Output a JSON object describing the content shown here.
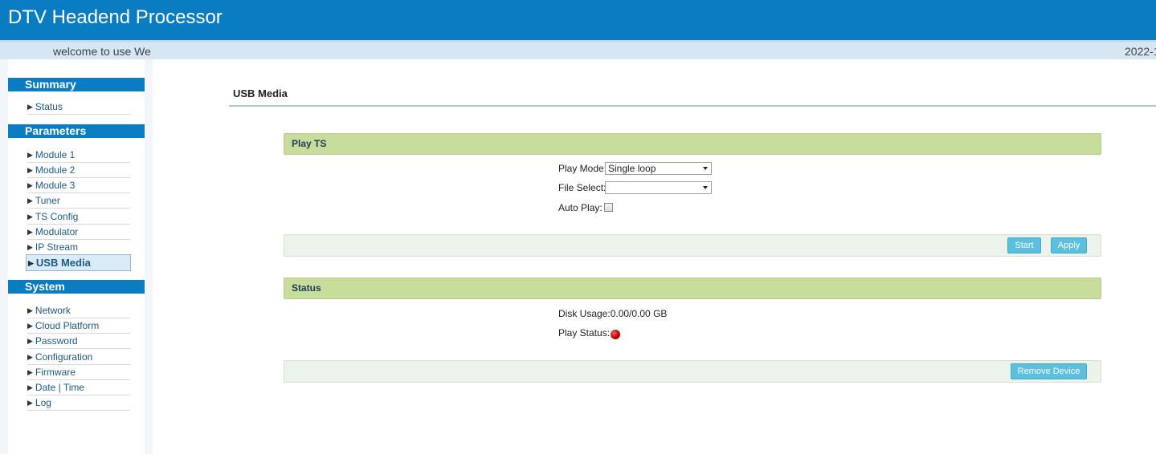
{
  "header": {
    "title": "DTV Headend Processor"
  },
  "welcome_bar": {
    "welcome": "welcome to use We",
    "date": "2022-1"
  },
  "sidebar": {
    "summary": {
      "label": "Summary",
      "items": [
        {
          "label": "Status"
        }
      ]
    },
    "parameters": {
      "label": "Parameters",
      "items": [
        {
          "label": "Module 1"
        },
        {
          "label": "Module 2"
        },
        {
          "label": "Module 3"
        },
        {
          "label": "Tuner"
        },
        {
          "label": "TS Config"
        },
        {
          "label": "Modulator"
        },
        {
          "label": "IP Stream"
        },
        {
          "label": "USB Media"
        }
      ]
    },
    "system": {
      "label": "System",
      "items": [
        {
          "label": "Network"
        },
        {
          "label": "Cloud Platform"
        },
        {
          "label": "Password"
        },
        {
          "label": "Configuration"
        },
        {
          "label": "Firmware"
        },
        {
          "label": "Date | Time"
        },
        {
          "label": "Log"
        }
      ]
    }
  },
  "main": {
    "title": "USB Media",
    "play_ts": {
      "header": "Play TS",
      "play_mode_label": "Play Mode:",
      "play_mode_value": "Single loop",
      "file_select_label": "File Select:",
      "file_select_value": "",
      "auto_play_label": "Auto Play:",
      "auto_play_checked": false,
      "start_label": "Start",
      "apply_label": "Apply"
    },
    "status": {
      "header": "Status",
      "disk_usage": "Disk Usage:0.00/0.00 GB",
      "play_status_label": "Play Status:",
      "remove_device_label": "Remove Device"
    }
  },
  "colors": {
    "header_bg": "#0a7dc2",
    "panel_header_bg": "#c8dd9c",
    "button_bg": "#5bc0de",
    "status_dot": "#c00000"
  }
}
